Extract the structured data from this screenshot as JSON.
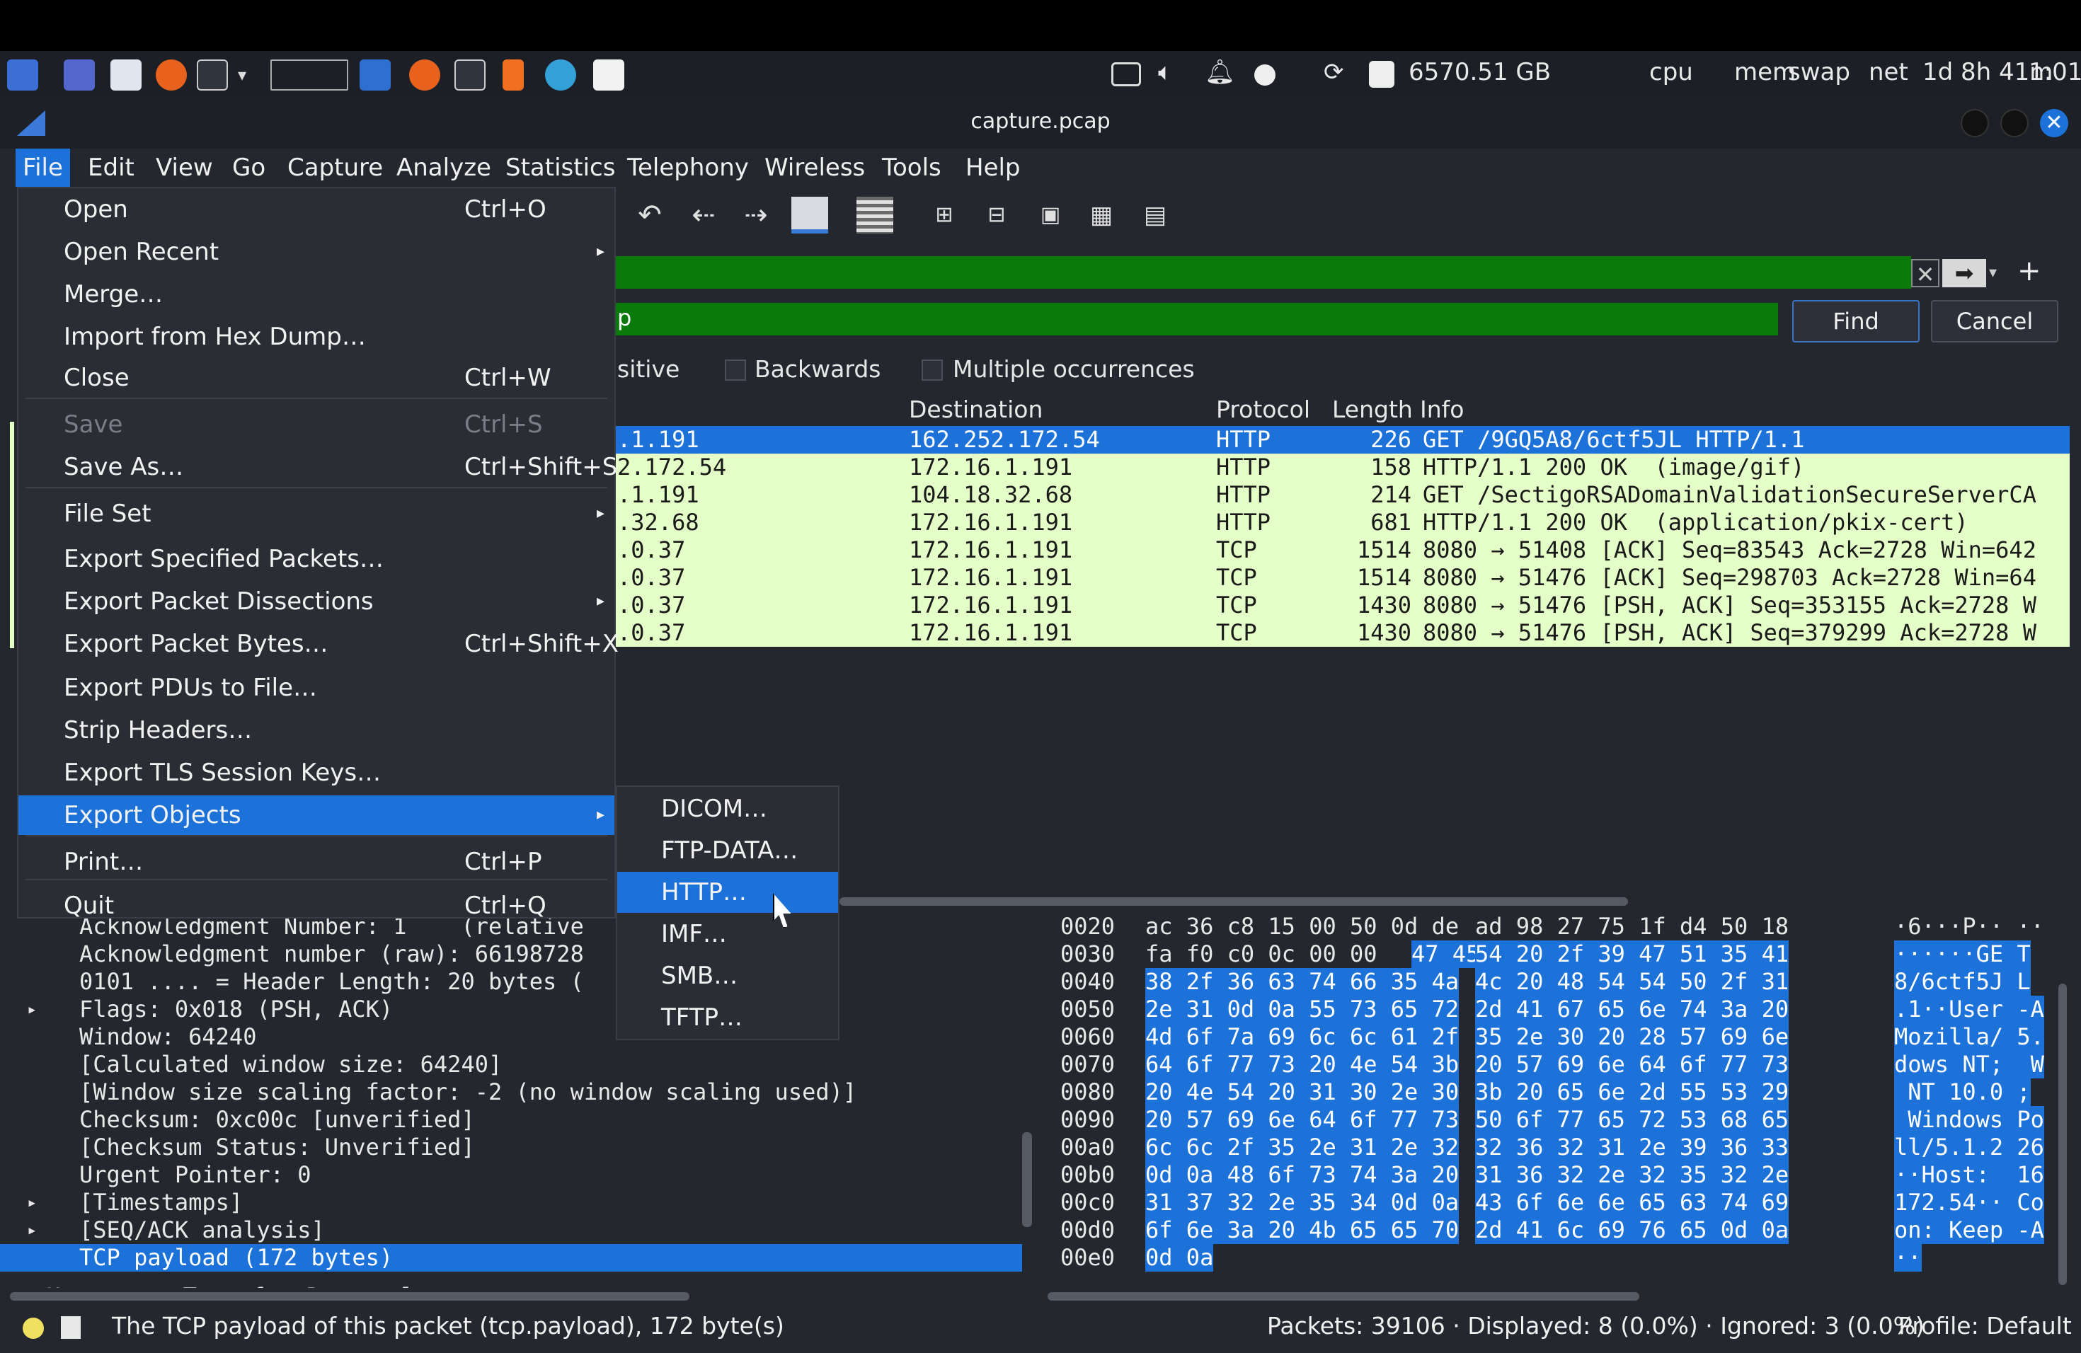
{
  "topbar": {
    "disk": "6570.51 GB",
    "cpu": "cpu",
    "mem": "mem",
    "swap": "swap",
    "net": "net",
    "uptime": "1d 8h 41m",
    "clock": "1:01"
  },
  "window": {
    "title": "capture.pcap"
  },
  "menubar": [
    "File",
    "Edit",
    "View",
    "Go",
    "Capture",
    "Analyze",
    "Statistics",
    "Telephony",
    "Wireless",
    "Tools",
    "Help"
  ],
  "search": {
    "text": "p",
    "find_label": "Find",
    "cancel_label": "Cancel",
    "case_label": "sitive",
    "backwards_label": "Backwards",
    "multiple_label": "Multiple occurrences"
  },
  "packet_list": {
    "headers": {
      "destination": "Destination",
      "protocol": "Protocol",
      "length": "Length",
      "info": "Info"
    },
    "rows": [
      {
        "src": ".1.191",
        "dst": "162.252.172.54",
        "proto": "HTTP",
        "len": "226",
        "info": "GET /9GQ5A8/6ctf5JL HTTP/1.1"
      },
      {
        "src": "2.172.54",
        "dst": "172.16.1.191",
        "proto": "HTTP",
        "len": "158",
        "info": "HTTP/1.1 200 OK  (image/gif)"
      },
      {
        "src": ".1.191",
        "dst": "104.18.32.68",
        "proto": "HTTP",
        "len": "214",
        "info": "GET /SectigoRSADomainValidationSecureServerCA"
      },
      {
        "src": ".32.68",
        "dst": "172.16.1.191",
        "proto": "HTTP",
        "len": "681",
        "info": "HTTP/1.1 200 OK  (application/pkix-cert)"
      },
      {
        "src": ".0.37",
        "dst": "172.16.1.191",
        "proto": "TCP",
        "len": "1514",
        "info": "8080 → 51408 [ACK] Seq=83543 Ack=2728 Win=642"
      },
      {
        "src": ".0.37",
        "dst": "172.16.1.191",
        "proto": "TCP",
        "len": "1514",
        "info": "8080 → 51476 [ACK] Seq=298703 Ack=2728 Win=64"
      },
      {
        "src": ".0.37",
        "dst": "172.16.1.191",
        "proto": "TCP",
        "len": "1430",
        "info": "8080 → 51476 [PSH, ACK] Seq=353155 Ack=2728 W"
      },
      {
        "src": ".0.37",
        "dst": "172.16.1.191",
        "proto": "TCP",
        "len": "1430",
        "info": "8080 → 51476 [PSH, ACK] Seq=379299 Ack=2728 W"
      }
    ]
  },
  "details": [
    {
      "text": "Acknowledgment Number: 1    (relative",
      "arrow": ""
    },
    {
      "text": "Acknowledgment number (raw): 66198728",
      "arrow": ""
    },
    {
      "text": "0101 .... = Header Length: 20 bytes (",
      "arrow": ""
    },
    {
      "text": "Flags: 0x018 (PSH, ACK)",
      "arrow": "▸"
    },
    {
      "text": "Window: 64240",
      "arrow": ""
    },
    {
      "text": "[Calculated window size: 64240]",
      "arrow": ""
    },
    {
      "text": "[Window size scaling factor: -2 (no window scaling used)]",
      "arrow": ""
    },
    {
      "text": "Checksum: 0xc00c [unverified]",
      "arrow": ""
    },
    {
      "text": "[Checksum Status: Unverified]",
      "arrow": ""
    },
    {
      "text": "Urgent Pointer: 0",
      "arrow": ""
    },
    {
      "text": "[Timestamps]",
      "arrow": "▸"
    },
    {
      "text": "[SEQ/ACK analysis]",
      "arrow": "▸"
    },
    {
      "text": "TCP payload (172 bytes)",
      "arrow": ""
    },
    {
      "text": "Hypertext Transfer Protocol",
      "arrow": ""
    }
  ],
  "hex": [
    {
      "off": "0020",
      "a": "ac 36 c8 15 00 50 0d de",
      "b": "ad 98 27 75 1f d4 50 18",
      "asc": "·6···P·· ··"
    },
    {
      "off": "0030",
      "a": "fa f0 c0 0c 00 00 47 45",
      "b": "54 20 2f 39 47 51 35 41",
      "asc": "······GE T"
    },
    {
      "off": "0040",
      "a": "38 2f 36 63 74 66 35 4a",
      "b": "4c 20 48 54 54 50 2f 31",
      "asc": "8/6ctf5J L"
    },
    {
      "off": "0050",
      "a": "2e 31 0d 0a 55 73 65 72",
      "b": "2d 41 67 65 6e 74 3a 20",
      "asc": ".1··User -A"
    },
    {
      "off": "0060",
      "a": "4d 6f 7a 69 6c 6c 61 2f",
      "b": "35 2e 30 20 28 57 69 6e",
      "asc": "Mozilla/ 5."
    },
    {
      "off": "0070",
      "a": "64 6f 77 73 20 4e 54 3b",
      "b": "20 57 69 6e 64 6f 77 73",
      "asc": "dows NT;  W"
    },
    {
      "off": "0080",
      "a": "20 4e 54 20 31 30 2e 30",
      "b": "3b 20 65 6e 2d 55 53 29",
      "asc": " NT 10.0 ;"
    },
    {
      "off": "0090",
      "a": "20 57 69 6e 64 6f 77 73",
      "b": "50 6f 77 65 72 53 68 65",
      "asc": " Windows Po"
    },
    {
      "off": "00a0",
      "a": "6c 6c 2f 35 2e 31 2e 32",
      "b": "32 36 32 31 2e 39 36 33",
      "asc": "ll/5.1.2 26"
    },
    {
      "off": "00b0",
      "a": "0d 0a 48 6f 73 74 3a 20",
      "b": "31 36 32 2e 32 35 32 2e",
      "asc": "··Host:  16"
    },
    {
      "off": "00c0",
      "a": "31 37 32 2e 35 34 0d 0a",
      "b": "43 6f 6e 6e 65 63 74 69",
      "asc": "172.54·· Co"
    },
    {
      "off": "00d0",
      "a": "6f 6e 3a 20 4b 65 65 70",
      "b": "2d 41 6c 69 76 65 0d 0a",
      "asc": "on: Keep -A"
    },
    {
      "off": "00e0",
      "a": "0d 0a",
      "b": "",
      "asc": "··"
    }
  ],
  "file_menu": [
    {
      "label": "Open",
      "shortcut": "Ctrl+O",
      "submenu": false,
      "disabled": false
    },
    {
      "label": "Open Recent",
      "shortcut": "",
      "submenu": true,
      "disabled": false
    },
    {
      "label": "Merge…",
      "shortcut": "",
      "submenu": false,
      "disabled": false
    },
    {
      "label": "Import from Hex Dump…",
      "shortcut": "",
      "submenu": false,
      "disabled": false
    },
    {
      "label": "Close",
      "shortcut": "Ctrl+W",
      "submenu": false,
      "disabled": false
    },
    {
      "label": "Save",
      "shortcut": "Ctrl+S",
      "submenu": false,
      "disabled": true
    },
    {
      "label": "Save As…",
      "shortcut": "Ctrl+Shift+S",
      "submenu": false,
      "disabled": false
    },
    {
      "label": "File Set",
      "shortcut": "",
      "submenu": true,
      "disabled": false
    },
    {
      "label": "Export Specified Packets…",
      "shortcut": "",
      "submenu": false,
      "disabled": false
    },
    {
      "label": "Export Packet Dissections",
      "shortcut": "",
      "submenu": true,
      "disabled": false
    },
    {
      "label": "Export Packet Bytes…",
      "shortcut": "Ctrl+Shift+X",
      "submenu": false,
      "disabled": false
    },
    {
      "label": "Export PDUs to File…",
      "shortcut": "",
      "submenu": false,
      "disabled": false
    },
    {
      "label": "Strip Headers…",
      "shortcut": "",
      "submenu": false,
      "disabled": false
    },
    {
      "label": "Export TLS Session Keys…",
      "shortcut": "",
      "submenu": false,
      "disabled": false
    },
    {
      "label": "Export Objects",
      "shortcut": "",
      "submenu": true,
      "disabled": false
    },
    {
      "label": "Print…",
      "shortcut": "Ctrl+P",
      "submenu": false,
      "disabled": false
    },
    {
      "label": "Quit",
      "shortcut": "Ctrl+Q",
      "submenu": false,
      "disabled": false
    }
  ],
  "export_objects_menu": [
    "DICOM…",
    "FTP-DATA…",
    "HTTP…",
    "IMF…",
    "SMB…",
    "TFTP…"
  ],
  "statusbar": {
    "message": "The TCP payload of this packet (tcp.payload), 172 byte(s)",
    "packets": "Packets: 39106 · Displayed: 8 (0.0%) · Ignored: 3 (0.0%)",
    "profile": "Profile: Default"
  },
  "colors": {
    "accent": "#1c72d8",
    "filter_ok": "#0a7a0a",
    "row_bg": "#e4ffc7"
  }
}
